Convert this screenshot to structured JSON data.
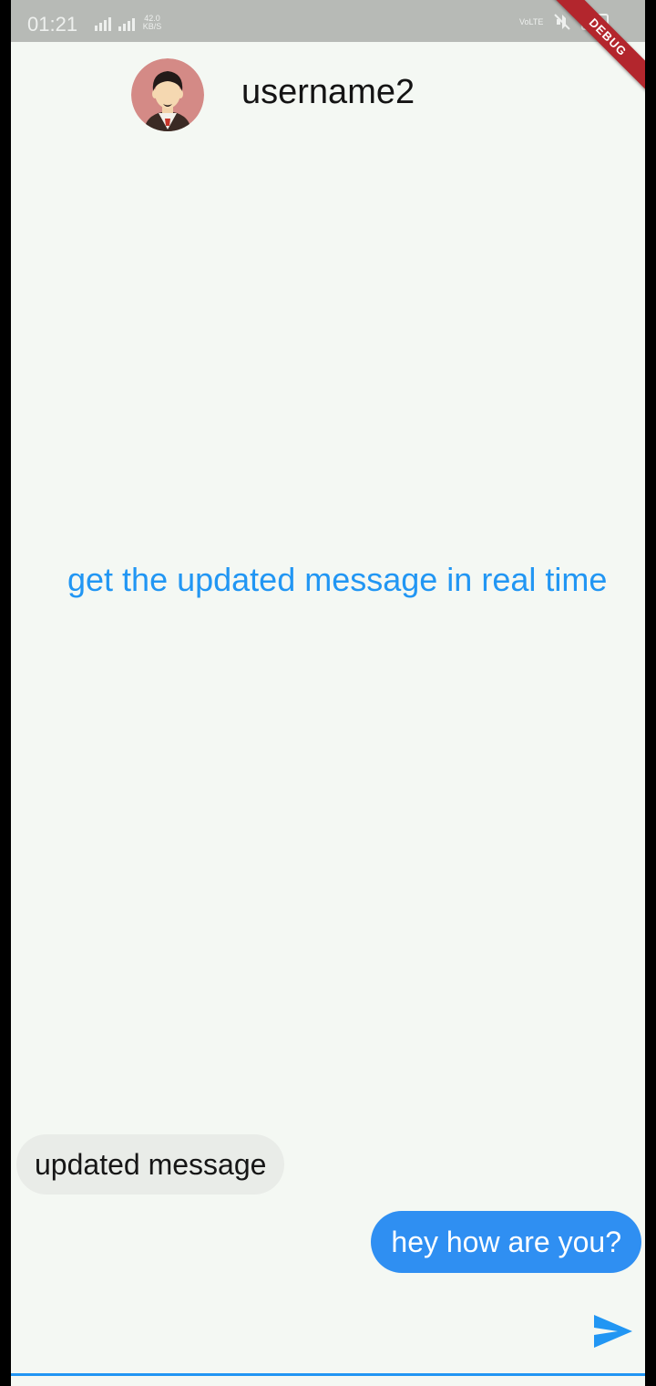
{
  "status_bar": {
    "time": "01:21",
    "net_speed": "42.0 KB/S",
    "volte_label": "VoLTE"
  },
  "debug_banner": "DEBUG",
  "header": {
    "username": "username2"
  },
  "center_note": "get the updated message in real time",
  "messages": [
    {
      "text": "updated message",
      "direction": "received"
    },
    {
      "text": "hey how are you?",
      "direction": "sent"
    }
  ],
  "composer": {
    "value": "",
    "placeholder": ""
  },
  "colors": {
    "accent": "#2196f3",
    "sent_bubble": "#2f8ff2",
    "received_bubble": "#e9ece8",
    "background": "#f4f8f3",
    "debug_banner": "#b3262d"
  },
  "icons": {
    "send": "send-icon",
    "avatar": "avatar"
  }
}
